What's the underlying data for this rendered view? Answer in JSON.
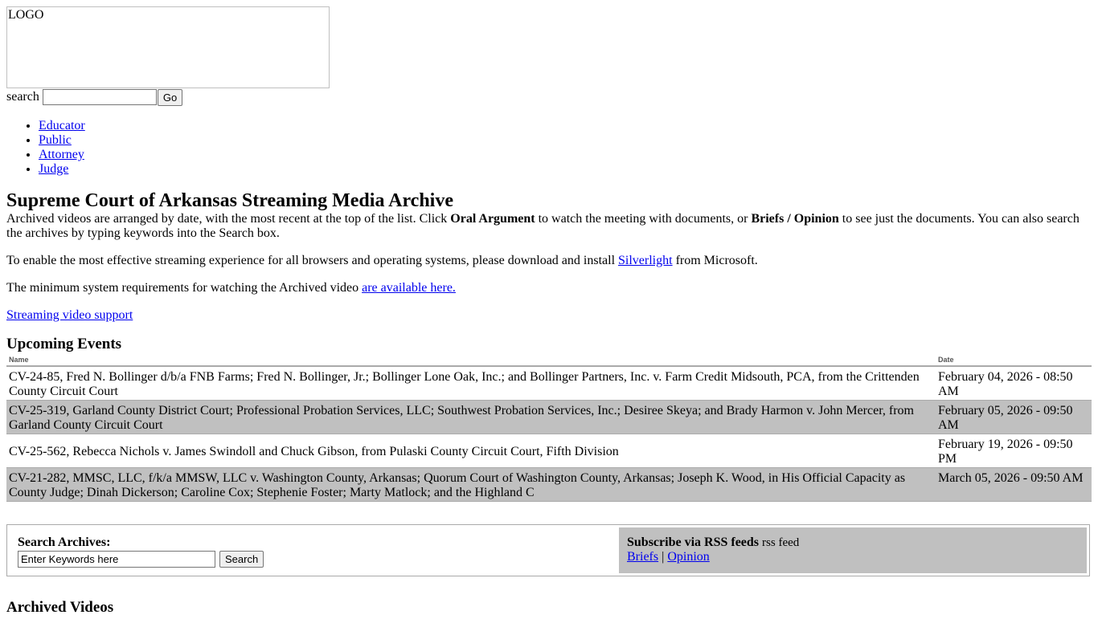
{
  "logo_alt": "LOGO",
  "header": {
    "search_label": "search",
    "search_value": "",
    "go_label": "Go"
  },
  "roles": [
    "Educator",
    "Public",
    "Attorney",
    "Judge"
  ],
  "main": {
    "title": "Supreme Court of Arkansas Streaming Media Archive",
    "intro_1": "Archived videos are arranged by date, with the most recent at the top of the list. Click ",
    "intro_bold_1": "Oral Argument",
    "intro_2": " to watch the meeting with documents, or ",
    "intro_bold_2": "Briefs / Opinion",
    "intro_3": " to see just the documents. You can also search the archives by typing keywords into the Search box.",
    "silverlight_pre": "To enable the most effective streaming experience for all browsers and operating systems, please download and install ",
    "silverlight_link": "Silverlight",
    "silverlight_post": " from Microsoft.",
    "req_pre": "The minimum system requirements for watching the Archived video ",
    "req_link": "are available here.",
    "support_link": "Streaming video support"
  },
  "upcoming": {
    "heading": "Upcoming Events",
    "col_name": "Name",
    "col_date": "Date",
    "rows": [
      {
        "name": "CV-24-85, Fred N. Bollinger d/b/a FNB Farms; Fred N. Bollinger, Jr.; Bollinger Lone Oak, Inc.; and Bollinger Partners, Inc. v. Farm Credit Midsouth, PCA, from the Crittenden County Circuit Court",
        "date": "February 04, 2026 - 08:50 AM"
      },
      {
        "name": "CV-25-319, Garland County District Court; Professional Probation Services, LLC; Southwest Probation Services, Inc.; Desiree Skeya; and Brady Harmon v. John Mercer, from Garland County Circuit Court",
        "date": "February 05, 2026 - 09:50 AM"
      },
      {
        "name": "CV-25-562, Rebecca Nichols v. James Swindoll and Chuck Gibson, from Pulaski County Circuit Court, Fifth Division",
        "date": "February 19, 2026 - 09:50 PM"
      },
      {
        "name": "CV-21-282, MMSC, LLC, f/k/a MMSW, LLC v. Washington County, Arkansas; Quorum Court of Washington County, Arkansas; Joseph K. Wood, in His Official Capacity as County Judge; Dinah Dickerson; Caroline Cox; Stephenie Foster; Marty Matlock; and the Highland C",
        "date": "March 05, 2026 - 09:50 AM"
      }
    ]
  },
  "archive_search": {
    "label": "Search Archives:",
    "value": "Enter Keywords here",
    "button": "Search"
  },
  "rss": {
    "label": "Subscribe via RSS feeds",
    "img_alt": "rss feed",
    "briefs": "Briefs",
    "sep": "|",
    "opinion": "Opinion"
  },
  "archived_heading": "Archived Videos"
}
